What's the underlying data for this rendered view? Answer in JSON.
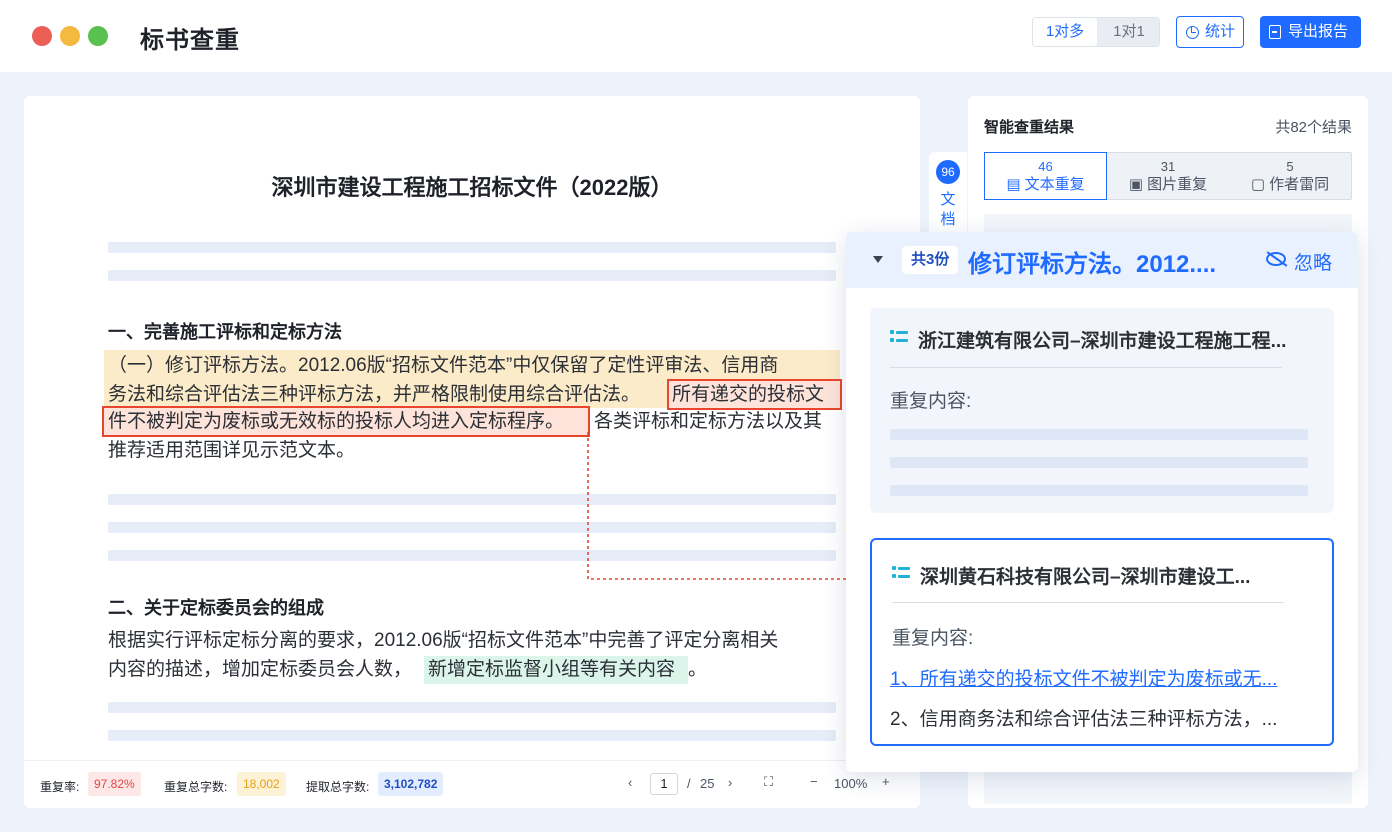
{
  "app": {
    "title": "标书查重"
  },
  "toolbar": {
    "mode_one_to_many": "1对多",
    "mode_one_to_one": "1对1",
    "stats_label": "统计",
    "export_label": "导出报告"
  },
  "document": {
    "title": "深圳市建设工程施工招标文件（2022版）",
    "section1_heading": "一、完善施工评标和定标方法",
    "para1": {
      "line1": "（一）修订评标方法。2012.06版“招标文件范本”中仅保留了定性评审法、信用商",
      "line2a": "务法和综合评估法三种评标方法，并严格限制使用综合评估法。",
      "line2b": "所有递交的投标文",
      "line3a": "件不被判定为废标或无效标的投标人均进入定标程序。",
      "line3b": "各类评标和定标方法以及其",
      "line4": "推荐适用范围详见示范文本。"
    },
    "section2_heading": "二、关于定标委员会的组成",
    "para2": {
      "line1": "根据实行评标定标分离的要求，2012.06版“招标文件范本”中完善了评定分离相关",
      "line2a": "内容的描述，增加定标委员会人数，",
      "line2b": "新增定标监督小组等有关内容",
      "line2c": "。"
    }
  },
  "statusbar": {
    "dup_rate_label": "重复率:",
    "dup_rate_value": "97.82%",
    "dup_chars_label": "重复总字数:",
    "dup_chars_value": "18,002",
    "extract_chars_label": "提取总字数:",
    "extract_chars_value": "3,102,782",
    "current_page": "1",
    "page_sep": "/",
    "total_pages": "25",
    "zoom": "100%"
  },
  "side_tab": {
    "badge": "96",
    "label": "文档"
  },
  "results": {
    "heading": "智能查重结果",
    "count": "共82个结果",
    "tabs": [
      {
        "count": "46",
        "label": "文本重复",
        "icon": "document-icon"
      },
      {
        "count": "31",
        "label": "图片重复",
        "icon": "image-icon"
      },
      {
        "count": "5",
        "label": "作者雷同",
        "icon": "author-icon"
      }
    ]
  },
  "popup": {
    "count_badge": "共3份",
    "title": "修订评标方法。2012....",
    "ignore_label": "忽略",
    "cards": [
      {
        "title": "浙江建筑有限公司–深圳市建设工程施工程...",
        "dup_label": "重复内容:"
      },
      {
        "title": "深圳黄石科技有限公司–深圳市建设工...",
        "dup_label": "重复内容:",
        "matches": [
          "1、所有递交的投标文件不被判定为废标或无...",
          "2、信用商务法和综合评估法三种评标方法，..."
        ]
      }
    ]
  },
  "colors": {
    "accent": "#1f6bff",
    "highlight_yellow": "#fcebc8",
    "highlight_red_border": "#e8462f",
    "highlight_green": "#dcf5ea"
  }
}
